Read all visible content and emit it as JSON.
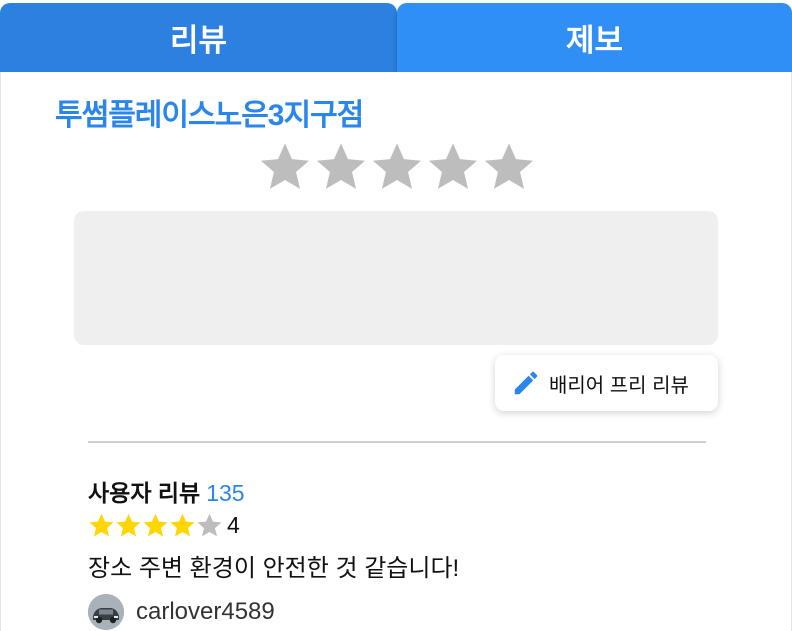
{
  "tabs": {
    "review_label": "리뷰",
    "report_label": "제보"
  },
  "place": {
    "name": "투썸플레이스노은3지구점"
  },
  "rating_input": {
    "stars_total": 5,
    "selected": 0
  },
  "review_input": {
    "placeholder": ""
  },
  "barrier_free_button": {
    "label": "배리어 프리 리뷰",
    "icon": "pencil-icon"
  },
  "reviews": {
    "header_label": "사용자 리뷰",
    "count": "135",
    "items": [
      {
        "rating": 4,
        "rating_label": "4",
        "text": "장소 주변 환경이 안전한 것 같습니다!",
        "username": "carlover4589"
      }
    ]
  },
  "colors": {
    "tab_active": "#2b80e0",
    "tab_inactive": "#2f8ff5",
    "accent": "#2b86ea",
    "star_filled": "#ffd600",
    "star_empty": "#bdbdbd"
  }
}
